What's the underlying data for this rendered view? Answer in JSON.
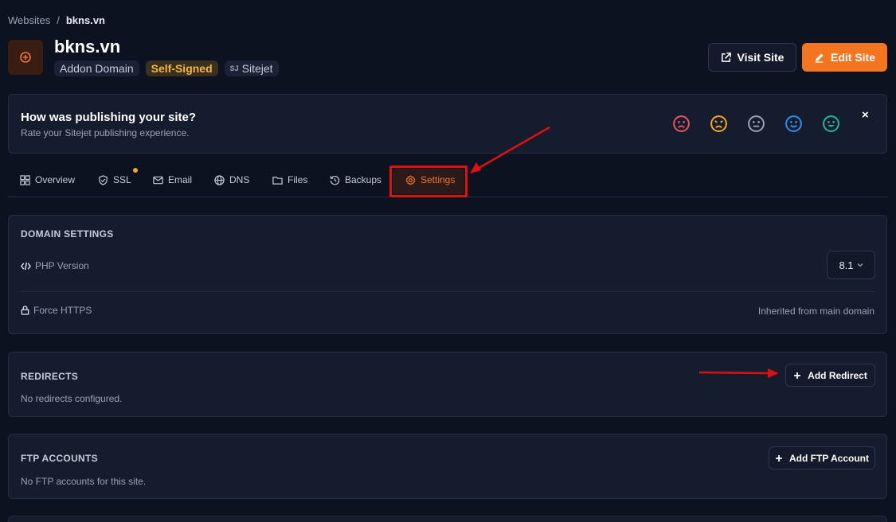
{
  "breadcrumb": {
    "parent": "Websites",
    "separator": "/",
    "current": "bkns.vn"
  },
  "header": {
    "title": "bkns.vn",
    "badges": {
      "type": "Addon Domain",
      "ssl": "Self-Signed",
      "builder": "Sitejet",
      "builder_icon_text": "SJ"
    },
    "visit_label": "Visit Site",
    "edit_label": "Edit Site"
  },
  "feedback": {
    "title": "How was publishing your site?",
    "subtitle": "Rate your Sitejet publishing experience.",
    "close": "×",
    "emojis": [
      {
        "icon": "very-unhappy-face-icon",
        "color": "#ef4f63"
      },
      {
        "icon": "unhappy-face-icon",
        "color": "#f5a623"
      },
      {
        "icon": "neutral-face-icon",
        "color": "#9aa3b5"
      },
      {
        "icon": "happy-face-icon",
        "color": "#2f8fef"
      },
      {
        "icon": "very-happy-face-icon",
        "color": "#1fb89a"
      }
    ]
  },
  "tabs": [
    {
      "label": "Overview",
      "icon": "grid-icon"
    },
    {
      "label": "SSL",
      "icon": "shield-icon"
    },
    {
      "label": "Email",
      "icon": "mail-icon"
    },
    {
      "label": "DNS",
      "icon": "globe-icon"
    },
    {
      "label": "Files",
      "icon": "folder-icon"
    },
    {
      "label": "Backups",
      "icon": "history-icon"
    },
    {
      "label": "Settings",
      "icon": "gear-icon",
      "active": true
    }
  ],
  "domain_settings": {
    "title": "DOMAIN SETTINGS",
    "php_label": "PHP Version",
    "php_value": "8.1",
    "https_label": "Force HTTPS",
    "https_value": "Inherited from main domain"
  },
  "redirects": {
    "title": "REDIRECTS",
    "empty": "No redirects configured.",
    "add_label": "Add Redirect"
  },
  "ftp": {
    "title": "FTP ACCOUNTS",
    "empty": "No FTP accounts for this site.",
    "add_label": "Add FTP Account"
  },
  "colors": {
    "accent": "#f47520",
    "annotation": "#e01010",
    "warning": "#f5b53d"
  }
}
